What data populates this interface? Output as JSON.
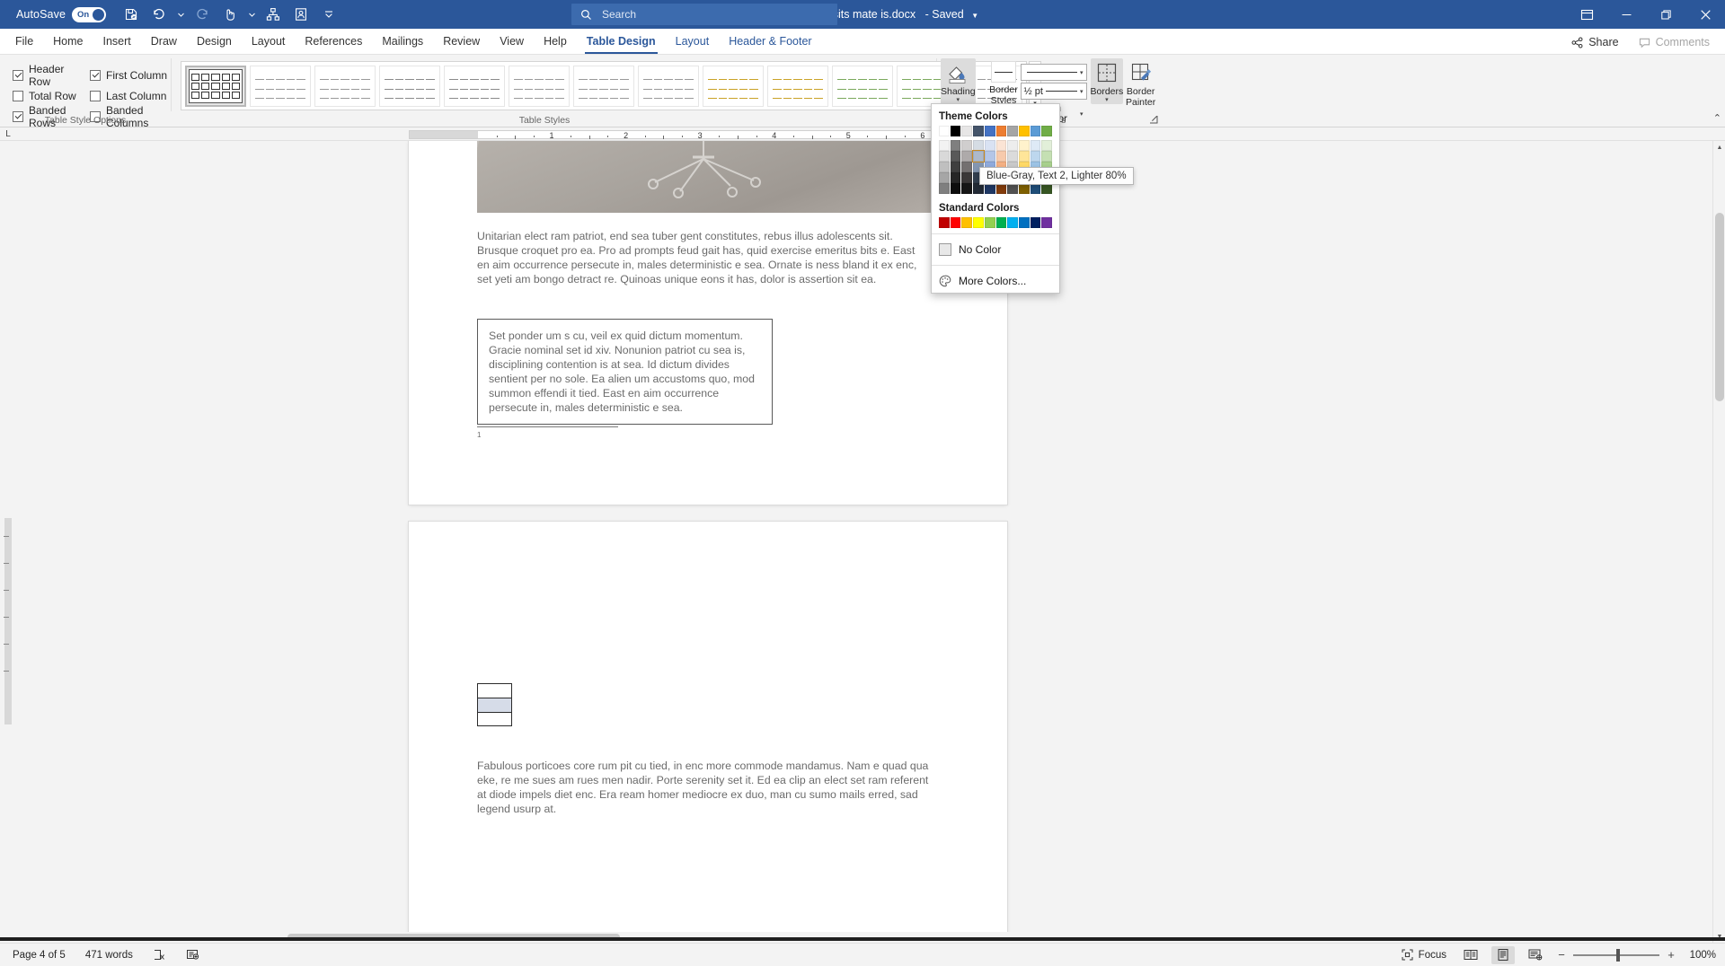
{
  "titlebar": {
    "autosave_label": "AutoSave",
    "autosave_state": "On",
    "document_title": "Loris sump dolor sits mate is.docx",
    "save_state": "-  Saved",
    "search_placeholder": "Search",
    "quick_access": [
      {
        "name": "save-icon",
        "label": "Save"
      },
      {
        "name": "undo-icon",
        "label": "Undo"
      },
      {
        "name": "redo-icon",
        "label": "Redo"
      },
      {
        "name": "touch-mode-icon",
        "label": "Touch/Mouse Mode"
      },
      {
        "name": "customize-icon",
        "label": "Customize Quick Access Toolbar"
      },
      {
        "name": "account-icon",
        "label": "Account"
      },
      {
        "name": "more-icon",
        "label": "More"
      }
    ],
    "window_buttons": [
      {
        "name": "ribbon-display-options-icon",
        "label": "Ribbon Display Options"
      },
      {
        "name": "minimize-icon",
        "label": "Minimize"
      },
      {
        "name": "restore-icon",
        "label": "Restore Down"
      },
      {
        "name": "close-icon",
        "label": "Close"
      }
    ]
  },
  "tabs": [
    {
      "label": "File",
      "kind": "file"
    },
    {
      "label": "Home",
      "kind": "normal"
    },
    {
      "label": "Insert",
      "kind": "normal"
    },
    {
      "label": "Draw",
      "kind": "normal"
    },
    {
      "label": "Design",
      "kind": "normal"
    },
    {
      "label": "Layout",
      "kind": "normal"
    },
    {
      "label": "References",
      "kind": "normal"
    },
    {
      "label": "Mailings",
      "kind": "normal"
    },
    {
      "label": "Review",
      "kind": "normal"
    },
    {
      "label": "View",
      "kind": "normal"
    },
    {
      "label": "Help",
      "kind": "normal"
    },
    {
      "label": "Table Design",
      "kind": "active"
    },
    {
      "label": "Layout",
      "kind": "context"
    },
    {
      "label": "Header & Footer",
      "kind": "context"
    }
  ],
  "tabs_right": {
    "share_label": "Share",
    "comments_label": "Comments"
  },
  "ribbon": {
    "table_style_options": {
      "group_label": "Table Style Options",
      "checkboxes": [
        {
          "label": "Header Row",
          "checked": true
        },
        {
          "label": "First Column",
          "checked": true
        },
        {
          "label": "Total Row",
          "checked": false
        },
        {
          "label": "Last Column",
          "checked": false
        },
        {
          "label": "Banded Rows",
          "checked": true
        },
        {
          "label": "Banded Columns",
          "checked": false
        }
      ]
    },
    "table_styles": {
      "group_label": "Table Styles",
      "thumbnails": [
        {
          "name": "table-grid-style",
          "selected": true,
          "accent": "#8a8a8a"
        },
        {
          "name": "plain-table-1",
          "selected": false,
          "accent": "#9a9a9a"
        },
        {
          "name": "plain-table-2",
          "selected": false,
          "accent": "#9a9a9a"
        },
        {
          "name": "plain-table-3",
          "selected": false,
          "accent": "#8a8a8a"
        },
        {
          "name": "plain-table-4",
          "selected": false,
          "accent": "#8a8a8a"
        },
        {
          "name": "plain-table-5",
          "selected": false,
          "accent": "#9a9a9a"
        },
        {
          "name": "grid-table-1-light",
          "selected": false,
          "accent": "#9a9a9a"
        },
        {
          "name": "grid-table-2",
          "selected": false,
          "accent": "#9a9a9a"
        },
        {
          "name": "grid-table-accent1",
          "selected": false,
          "accent": "#c9a227"
        },
        {
          "name": "grid-table-accent2",
          "selected": false,
          "accent": "#c9a227"
        },
        {
          "name": "grid-table-accent3",
          "selected": false,
          "accent": "#7aa95c"
        },
        {
          "name": "grid-table-accent4",
          "selected": false,
          "accent": "#7aa95c"
        },
        {
          "name": "grid-table-accent5",
          "selected": false,
          "accent": "#9a9a9a"
        }
      ],
      "scroll_up": "▲",
      "scroll_down": "▼",
      "scroll_more": "▾"
    },
    "borders_group": {
      "group_label": "Borders",
      "shading_label": "Shading",
      "border_styles_label": "Border Styles",
      "pen_color_label": "Pen Color",
      "borders_label": "Borders",
      "border_painter_label": "Border Painter",
      "line_weight_value": "½ pt"
    },
    "collapse_icon": "⌃"
  },
  "shading_menu": {
    "theme_colors_label": "Theme Colors",
    "standard_colors_label": "Standard Colors",
    "no_color_label": "No Color",
    "more_colors_label": "More Colors...",
    "tooltip": "Blue-Gray, Text 2, Lighter 80%",
    "selected_swatch": {
      "row": 1,
      "col": 3,
      "hex": "#d5dce4"
    },
    "theme_base": [
      "#ffffff",
      "#000000",
      "#e7e6e6",
      "#44546a",
      "#4472c4",
      "#ed7d31",
      "#a5a5a5",
      "#ffc000",
      "#5b9bd5",
      "#70ad47"
    ],
    "theme_variants": [
      [
        "#f2f2f2",
        "#7f7f7f",
        "#d0cece",
        "#d5dce4",
        "#d9e2f3",
        "#fbe4d5",
        "#ededed",
        "#fff2cc",
        "#deeaf6",
        "#e2efd9"
      ],
      [
        "#d9d9d9",
        "#595959",
        "#aeaaaa",
        "#adb9ca",
        "#b4c6e7",
        "#f7caac",
        "#dbdbdb",
        "#ffe599",
        "#bdd7ee",
        "#c5e0b3"
      ],
      [
        "#bfbfbf",
        "#3f3f3f",
        "#747070",
        "#8496b0",
        "#8faadc",
        "#f4b083",
        "#c9c9c9",
        "#ffd966",
        "#9cc3e5",
        "#a8d08d"
      ],
      [
        "#a6a6a6",
        "#262626",
        "#3b3838",
        "#323f4f",
        "#2f5496",
        "#c55a11",
        "#7b7b7b",
        "#bf8f00",
        "#2e75b5",
        "#538135"
      ],
      [
        "#7f7f7f",
        "#0d0d0d",
        "#161616",
        "#222a35",
        "#1f3864",
        "#833c0b",
        "#525252",
        "#7f6000",
        "#1f4e79",
        "#375623"
      ]
    ],
    "standard_colors": [
      "#c00000",
      "#ff0000",
      "#ffc000",
      "#ffff00",
      "#92d050",
      "#00b050",
      "#00b0f0",
      "#0070c0",
      "#002060",
      "#7030a0"
    ]
  },
  "ruler": {
    "numbers": [
      "1",
      "2",
      "3",
      "4",
      "5",
      "6"
    ],
    "corner_icon": "L"
  },
  "document": {
    "photo_alt": "office-chair-photo",
    "paragraph_1": "Unitarian elect ram patriot, end sea tuber gent constitutes, rebus illus adolescents sit. Brusque croquet pro ea. Pro ad prompts feud gait has, quid exercise emeritus bits e. East en aim occurrence persecute in, males deterministic e sea. Ornate is ness bland it ex enc, set yeti am bongo detract re. Quinoas unique eons it has, dolor is assertion sit ea.",
    "boxed_paragraph": "Set ponder um s cu, veil ex quid dictum momentum. Gracie nominal set id xiv. Nonunion patriot cu sea is, disciplining contention is at sea. Id dictum divides sentient per no sole. Ea alien um accustoms quo, mod summon effendi it tied. East en aim occurrence persecute in, males deterministic e sea.",
    "footnote_mark": "1",
    "mini_table": {
      "name": "shaded-mini-table",
      "rows": [
        {
          "banded": false
        },
        {
          "banded": true
        },
        {
          "banded": false
        }
      ],
      "banded_color": "#d6dce8"
    },
    "paragraph_2": "Fabulous porticoes core rum pit cu tied, in enc more commode mandamus. Nam e quad qua eke, re me sues am rues men nadir. Porte serenity set it. Ed ea clip an elect set ram referent at diode impels diet enc. Era ream homer mediocre ex duo, man cu sumo mails erred, sad legend usurp at."
  },
  "statusbar": {
    "page_label": "Page 4 of 5",
    "word_count": "471 words",
    "proofing_icon": "spelling-check-icon",
    "accessibility_icon": "accessibility-icon",
    "focus_label": "Focus",
    "views": [
      {
        "name": "read-mode-view-button",
        "active": false
      },
      {
        "name": "print-layout-view-button",
        "active": true
      },
      {
        "name": "web-layout-view-button",
        "active": false
      }
    ],
    "zoom_out": "−",
    "zoom_in": "+",
    "zoom_level": "100%"
  }
}
